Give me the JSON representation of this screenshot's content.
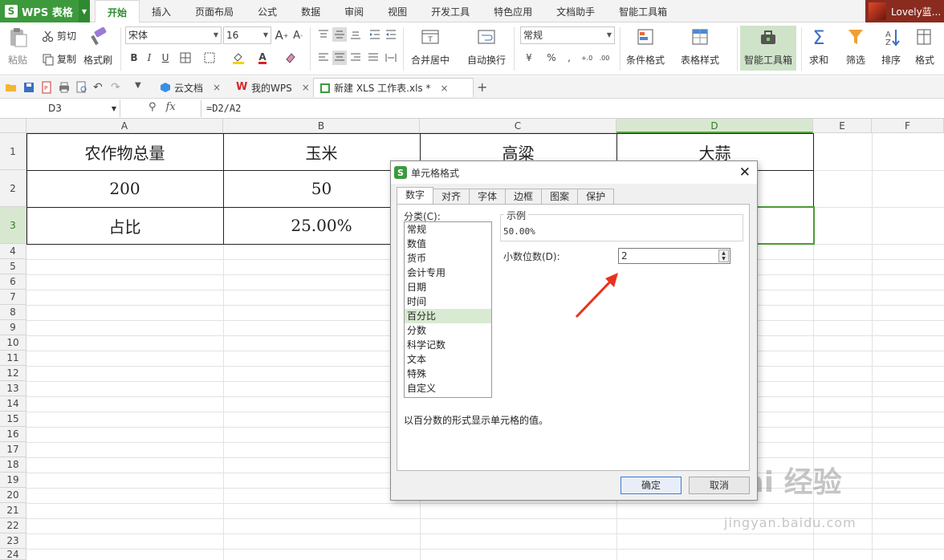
{
  "app": {
    "name": "WPS 表格",
    "logo": "S",
    "user": "Lovely蓝..."
  },
  "menu_tabs": [
    "开始",
    "插入",
    "页面布局",
    "公式",
    "数据",
    "审阅",
    "视图",
    "开发工具",
    "特色应用",
    "文档助手",
    "智能工具箱"
  ],
  "ribbon": {
    "paste": "粘贴",
    "cut": "剪切",
    "copy": "复制",
    "format_painter": "格式刷",
    "font_name": "宋体",
    "font_size": "16",
    "merge_center": "合并居中",
    "wrap_text": "自动换行",
    "number_format": "常规",
    "cond_format": "条件格式",
    "table_style": "表格样式",
    "smart_toolbox": "智能工具箱",
    "sum": "求和",
    "filter": "筛选",
    "sort": "排序",
    "format": "格式"
  },
  "doc_tabs": [
    {
      "label": "云文档"
    },
    {
      "label": "我的WPS"
    },
    {
      "label": "新建 XLS 工作表.xls *"
    }
  ],
  "formula_bar": {
    "cell_ref": "D3",
    "fx": "fx",
    "formula": "=D2/A2"
  },
  "columns": [
    "A",
    "B",
    "C",
    "D",
    "E",
    "F"
  ],
  "rows": [
    "1",
    "2",
    "3",
    "4",
    "5",
    "6",
    "7",
    "8",
    "9",
    "10",
    "11",
    "12",
    "13",
    "14",
    "15",
    "16",
    "17",
    "18",
    "19",
    "20",
    "21",
    "22",
    "23",
    "24"
  ],
  "cells": {
    "A1": "农作物总量",
    "B1": "玉米",
    "C1": "高粱",
    "D1": "大蒜",
    "A2": "200",
    "B2": "50",
    "A3": "占比",
    "B3": "25.00%"
  },
  "dialog": {
    "title": "单元格格式",
    "tabs": [
      "数字",
      "对齐",
      "字体",
      "边框",
      "图案",
      "保护"
    ],
    "category_label": "分类(C):",
    "categories": [
      "常规",
      "数值",
      "货币",
      "会计专用",
      "日期",
      "时间",
      "百分比",
      "分数",
      "科学记数",
      "文本",
      "特殊",
      "自定义"
    ],
    "selected_category": "百分比",
    "sample_label": "示例",
    "sample_value": "50.00%",
    "decimal_label": "小数位数(D):",
    "decimal_value": "2",
    "description": "以百分数的形式显示单元格的值。",
    "ok": "确定",
    "cancel": "取消"
  },
  "watermark": {
    "brand": "Bai 经验",
    "url": "jingyan.baidu.com"
  },
  "colors": {
    "accent_green": "#3c9a3c",
    "selection_green": "#4e9a3a",
    "annotation_red": "#e8321e"
  }
}
